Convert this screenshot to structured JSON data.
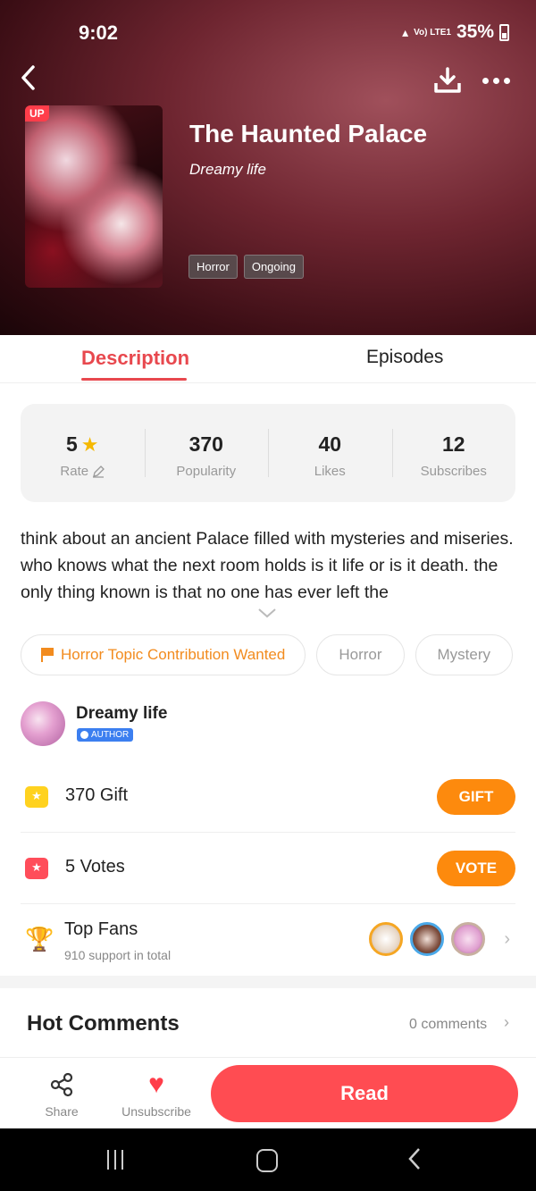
{
  "status_bar": {
    "time": "9:02",
    "network": "Vo) LTE1",
    "battery": "35%"
  },
  "header": {
    "title": "The Haunted Palace",
    "author": "Dreamy life",
    "cover_badge": "UP",
    "tags": [
      "Horror",
      "Ongoing"
    ]
  },
  "tabs": [
    {
      "label": "Description",
      "active": true
    },
    {
      "label": "Episodes",
      "active": false
    }
  ],
  "stats": [
    {
      "value": "5",
      "label": "Rate"
    },
    {
      "value": "370",
      "label": "Popularity"
    },
    {
      "value": "40",
      "label": "Likes"
    },
    {
      "value": "12",
      "label": "Subscribes"
    }
  ],
  "description": "think about an ancient Palace filled with mysteries and miseries. who knows what the next room holds is it life or is it death. the only thing known is that no one has ever left the",
  "chips": [
    "Horror Topic Contribution Wanted",
    "Horror",
    "Mystery"
  ],
  "author": {
    "name": "Dreamy life",
    "badge": "AUTHOR"
  },
  "gift": {
    "text": "370 Gift",
    "button": "GIFT"
  },
  "vote": {
    "text": "5 Votes",
    "button": "VOTE"
  },
  "fans": {
    "title": "Top Fans",
    "subtitle": "910 support in total"
  },
  "comments": {
    "title": "Hot Comments",
    "count": "0 comments"
  },
  "bottom_bar": {
    "share": "Share",
    "unsubscribe": "Unsubscribe",
    "read": "Read"
  },
  "colors": {
    "accent": "#e8484e",
    "orange": "#fd8a0d",
    "read_button": "#ff4c52"
  }
}
